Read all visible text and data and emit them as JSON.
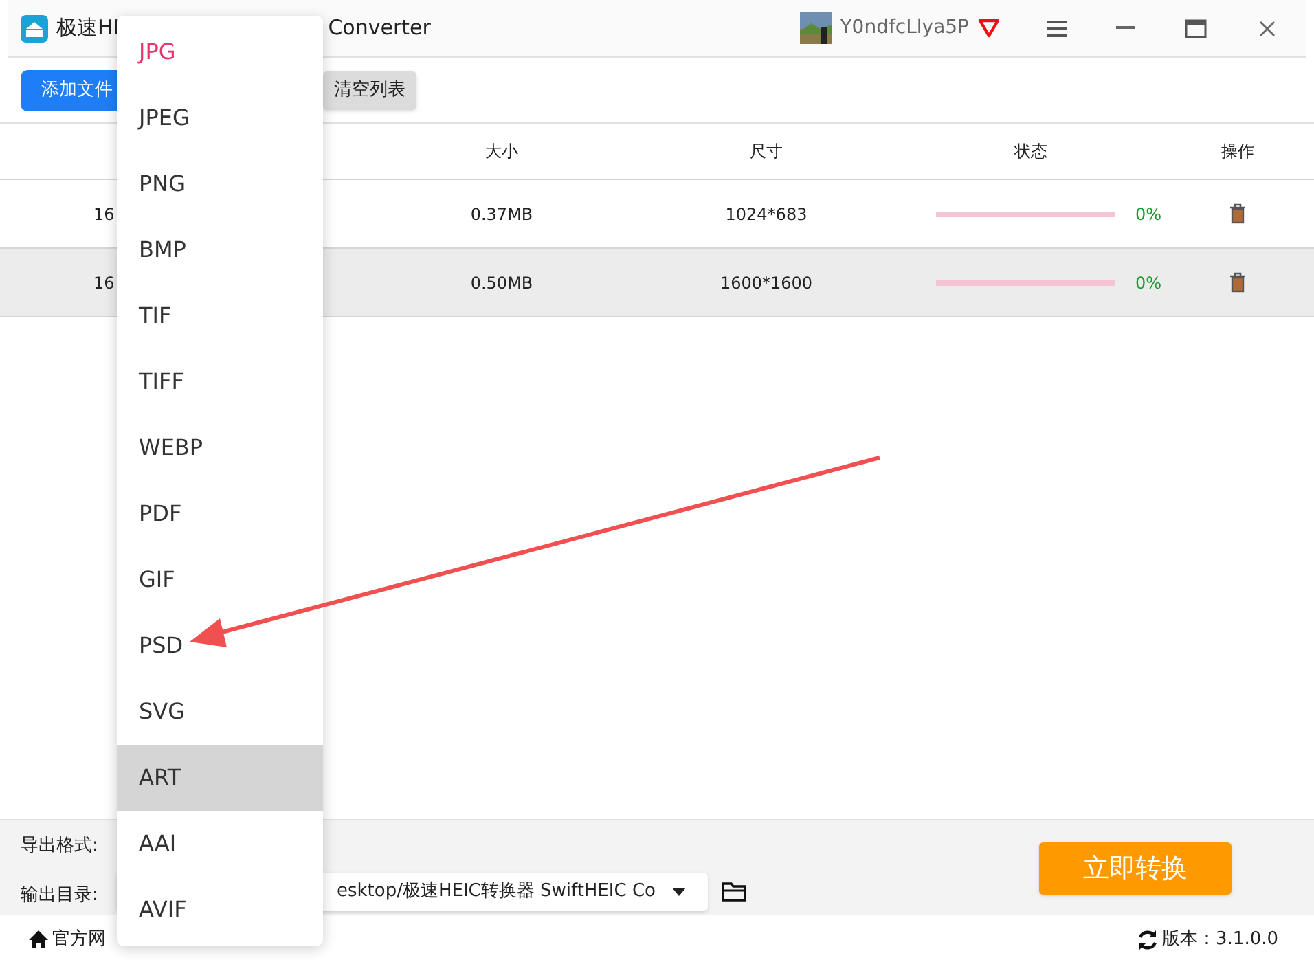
{
  "window": {
    "title_left": "极速HI",
    "title_right": "Converter",
    "user": "Y0ndfcLlya5P"
  },
  "toolbar": {
    "add_button": "添加文件",
    "clear_button": "清空列表"
  },
  "table": {
    "columns": [
      "大小",
      "尺寸",
      "状态",
      "操作"
    ],
    "rows": [
      {
        "name": "16",
        "size": "0.37MB",
        "dimensions": "1024*683",
        "level": 0,
        "percent": "0%",
        "selected": false
      },
      {
        "name": "16",
        "size": "0.50MB",
        "dimensions": "1600*1600",
        "level": 0,
        "percent": "0%",
        "selected": true
      }
    ]
  },
  "format_menu": {
    "items": [
      {
        "label": "JPG",
        "current": true,
        "selected": false
      },
      {
        "label": "JPEG",
        "current": false,
        "selected": false
      },
      {
        "label": "PNG",
        "current": false,
        "selected": false
      },
      {
        "label": "BMP",
        "current": false,
        "selected": false
      },
      {
        "label": "TIF",
        "current": false,
        "selected": false
      },
      {
        "label": "TIFF",
        "current": false,
        "selected": false
      },
      {
        "label": "WEBP",
        "current": false,
        "selected": false
      },
      {
        "label": "PDF",
        "current": false,
        "selected": false
      },
      {
        "label": "GIF",
        "current": false,
        "selected": false
      },
      {
        "label": "PSD",
        "current": false,
        "selected": false
      },
      {
        "label": "SVG",
        "current": false,
        "selected": false
      },
      {
        "label": "ART",
        "current": false,
        "selected": true
      },
      {
        "label": "AAI",
        "current": false,
        "selected": false
      },
      {
        "label": "AVIF",
        "current": false,
        "selected": false
      }
    ]
  },
  "settings": {
    "format_label": "导出格式:",
    "output_label": "输出目录:",
    "output_path": "esktop/极速HEIC转换器 SwiftHEIC Co",
    "convert_button": "立即转换"
  },
  "footer": {
    "website_link": "官方网",
    "version": "版本：3.1.0.0"
  }
}
